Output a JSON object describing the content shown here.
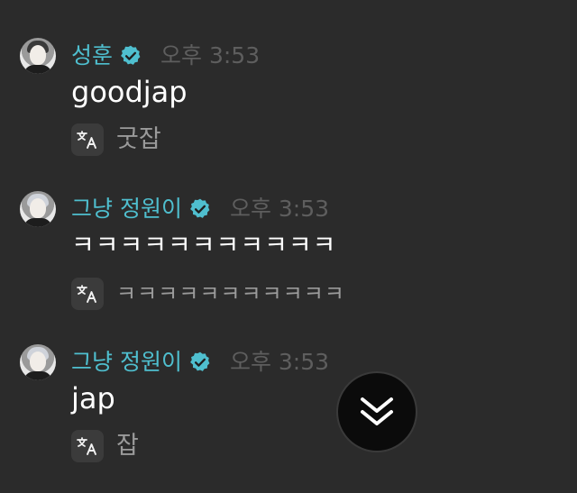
{
  "messages": [
    {
      "author": "성훈",
      "time": "오후 3:53",
      "text": "goodjap",
      "translation": "굿잡",
      "avatar_style": "dark-hair"
    },
    {
      "author": "그냥 정원이",
      "time": "오후 3:53",
      "text": "ㅋㅋㅋㅋㅋㅋㅋㅋㅋㅋㅋ",
      "translation": "ㅋㅋㅋㅋㅋㅋㅋㅋㅋㅋㅋ",
      "avatar_style": "light-hair"
    },
    {
      "author": "그냥 정원이",
      "time": "오후 3:53",
      "text": "jap",
      "translation": "잡",
      "avatar_style": "light-hair"
    }
  ],
  "icons": {
    "verified": "verified-badge-icon",
    "translate": "translate-icon",
    "scroll_down": "chevron-double-down-icon"
  },
  "colors": {
    "background": "#2b2b2b",
    "author": "#4fbfcf",
    "verified": "#4fbfcf",
    "time": "#5e5e5e",
    "text": "#ffffff",
    "translation": "#9a9a9a"
  }
}
